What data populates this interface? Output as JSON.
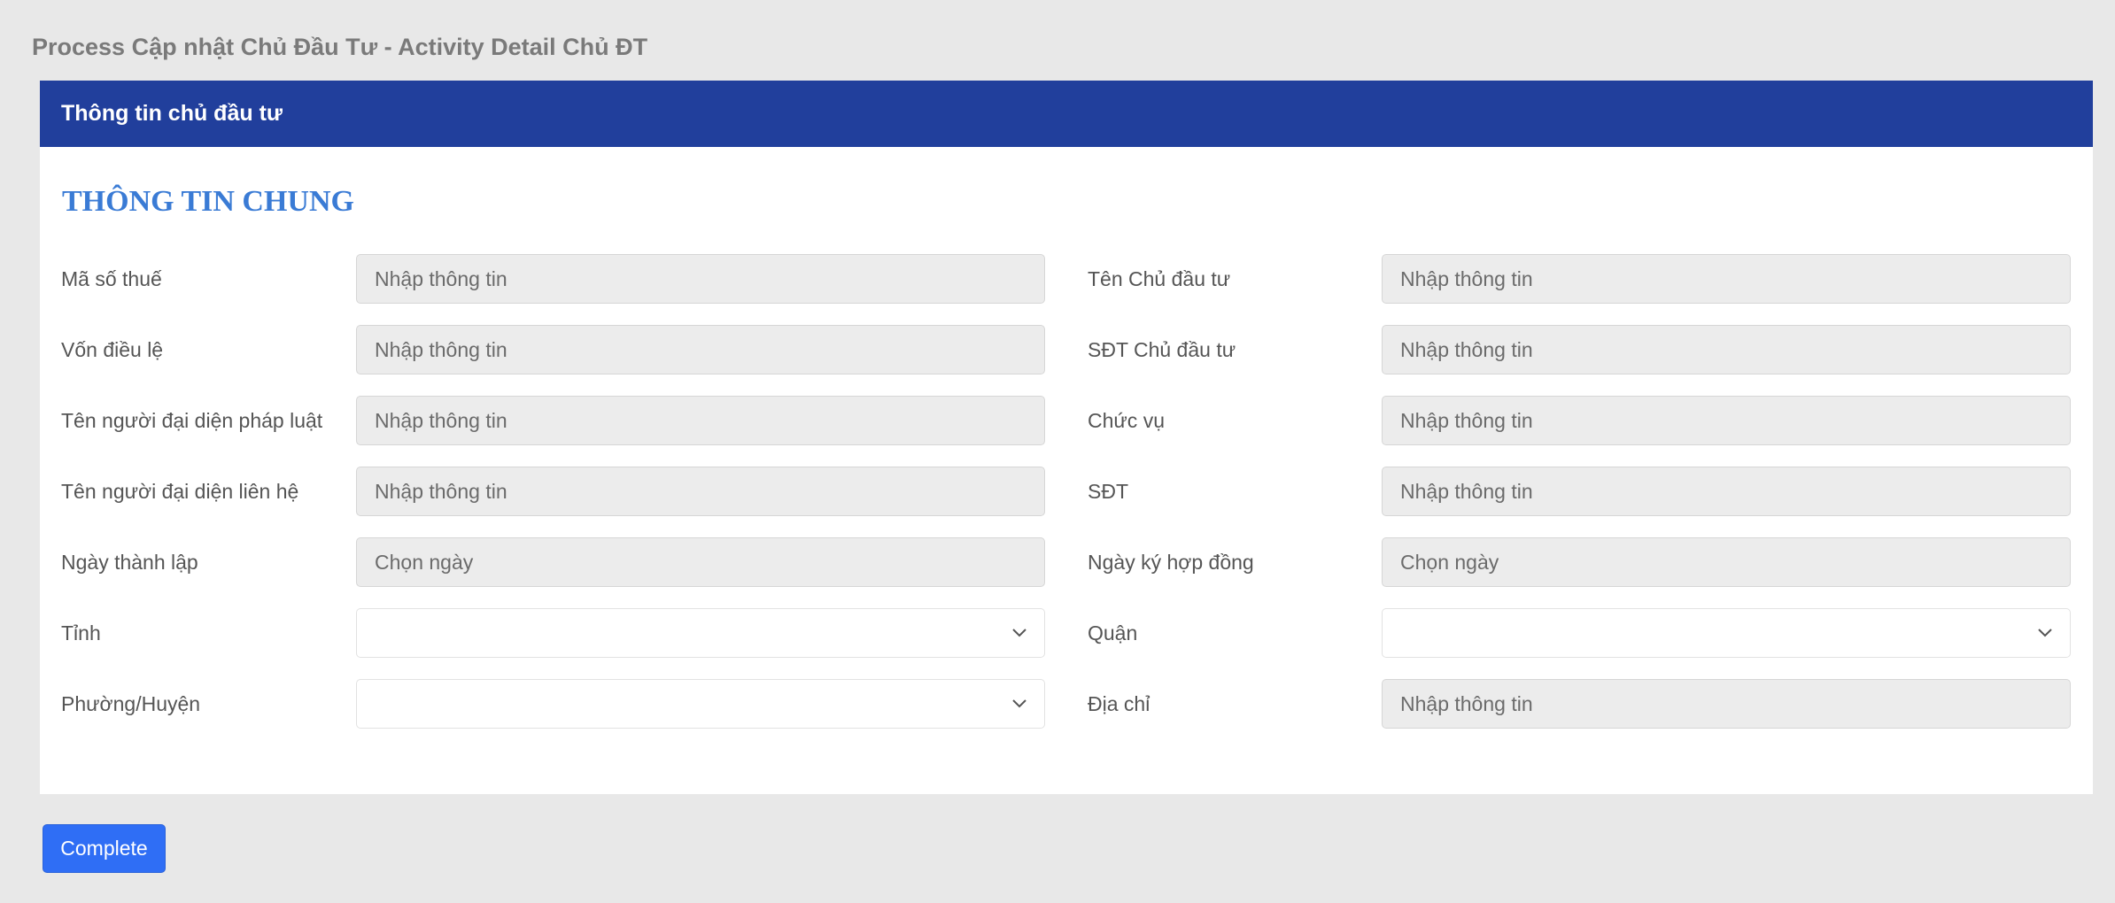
{
  "page": {
    "title": "Process Cập nhật Chủ Đầu Tư - Activity Detail Chủ ĐT"
  },
  "card": {
    "header": "Thông tin chủ đầu tư",
    "section_title": "THÔNG TIN CHUNG"
  },
  "form": {
    "left": [
      {
        "label": "Mã số thuế",
        "type": "text",
        "placeholder": "Nhập thông tin"
      },
      {
        "label": "Vốn điều lệ",
        "type": "text",
        "placeholder": "Nhập thông tin"
      },
      {
        "label": "Tên người đại diện pháp luật",
        "type": "text",
        "placeholder": "Nhập thông tin"
      },
      {
        "label": "Tên người đại diện liên hệ",
        "type": "text",
        "placeholder": "Nhập thông tin"
      },
      {
        "label": "Ngày thành lập",
        "type": "date",
        "placeholder": "Chọn ngày"
      },
      {
        "label": "Tỉnh",
        "type": "select",
        "placeholder": ""
      },
      {
        "label": "Phường/Huyện",
        "type": "select",
        "placeholder": ""
      }
    ],
    "right": [
      {
        "label": "Tên Chủ đầu tư",
        "type": "text",
        "placeholder": "Nhập thông tin"
      },
      {
        "label": "SĐT Chủ đầu tư",
        "type": "text",
        "placeholder": "Nhập thông tin"
      },
      {
        "label": "Chức vụ",
        "type": "text",
        "placeholder": "Nhập thông tin"
      },
      {
        "label": "SĐT",
        "type": "text",
        "placeholder": "Nhập thông tin"
      },
      {
        "label": "Ngày ký hợp đồng",
        "type": "date",
        "placeholder": "Chọn ngày"
      },
      {
        "label": "Quận",
        "type": "select",
        "placeholder": ""
      },
      {
        "label": "Địa chỉ",
        "type": "text",
        "placeholder": "Nhập thông tin"
      }
    ]
  },
  "actions": {
    "complete_label": "Complete"
  },
  "colors": {
    "header_bg": "#213f9c",
    "section_title": "#3a7bd5",
    "button_bg": "#2f6ef5",
    "page_bg": "#e8e8e8"
  },
  "icons": {
    "select_chevron": "chevron-down-icon"
  }
}
